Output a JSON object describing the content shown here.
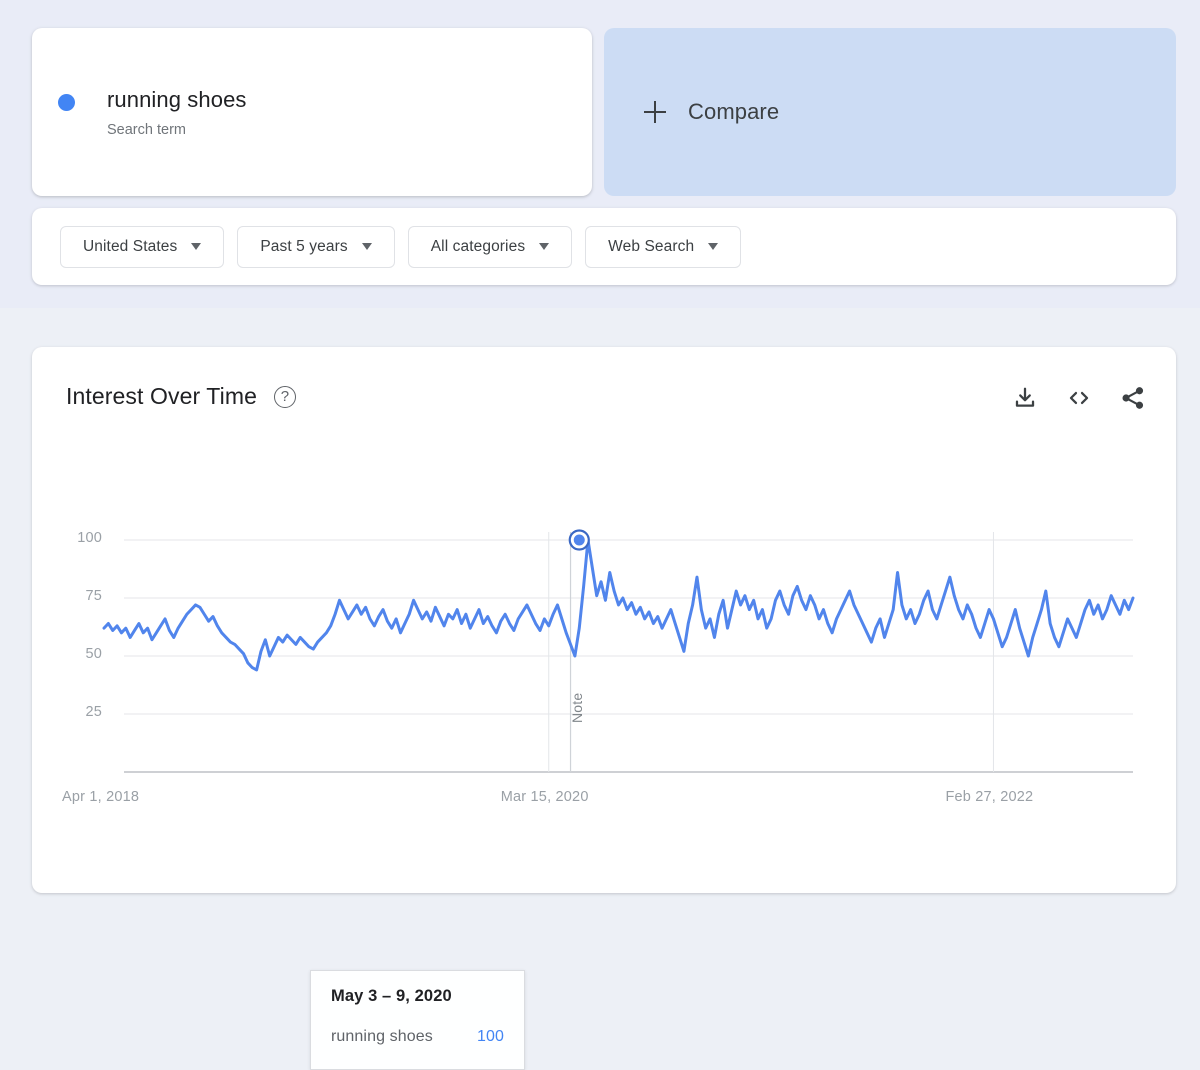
{
  "colors": {
    "series": "#5185ec",
    "series_dark": "#3b68c4",
    "accent_text": "#4285f4",
    "top_band": "#e9ecf7",
    "page_bg": "#edf0f6",
    "compare_bg": "#ccdcf4"
  },
  "term_card": {
    "name": "running shoes",
    "subtitle": "Search term",
    "dot_color": "#4285f4"
  },
  "compare_card": {
    "label": "Compare",
    "plus_icon": "plus-icon"
  },
  "filters": [
    {
      "label": "United States",
      "caret": "chevron-down-icon"
    },
    {
      "label": "Past 5 years",
      "caret": "chevron-down-icon"
    },
    {
      "label": "All categories",
      "caret": "chevron-down-icon"
    },
    {
      "label": "Web Search",
      "caret": "chevron-down-icon"
    }
  ],
  "chart_panel": {
    "title": "Interest Over Time",
    "help_icon": "help-icon",
    "help_glyph": "?",
    "actions": [
      {
        "name": "download-icon",
        "label": "Download CSV"
      },
      {
        "name": "embed-code-icon",
        "label": "Embed code"
      },
      {
        "name": "share-icon",
        "label": "Share"
      }
    ]
  },
  "tooltip": {
    "date": "May 3 – 9, 2020",
    "term": "running shoes",
    "value": "100"
  },
  "annotation": {
    "label": "Note",
    "x_value": 107
  },
  "chart_data": {
    "type": "line",
    "title": "Interest Over Time",
    "xlabel": "",
    "ylabel": "",
    "ylim": [
      0,
      100
    ],
    "yticks": [
      100,
      75,
      50,
      25
    ],
    "xticks": [
      "Apr 1, 2018",
      "Mar 15, 2020",
      "Feb 27, 2022"
    ],
    "xtick_indices": [
      0,
      102,
      204
    ],
    "grid": true,
    "legend": "none",
    "highlight": {
      "index": 109,
      "value": 100,
      "label": "May 3 – 9, 2020"
    },
    "series": [
      {
        "name": "running shoes",
        "color": "#5185ec",
        "values": [
          62,
          64,
          61,
          63,
          60,
          62,
          58,
          61,
          64,
          60,
          62,
          57,
          60,
          63,
          66,
          61,
          58,
          62,
          65,
          68,
          70,
          72,
          71,
          68,
          65,
          67,
          63,
          60,
          58,
          56,
          55,
          53,
          51,
          47,
          45,
          44,
          52,
          57,
          50,
          54,
          58,
          56,
          59,
          57,
          55,
          58,
          56,
          54,
          53,
          56,
          58,
          60,
          63,
          68,
          74,
          70,
          66,
          69,
          72,
          68,
          71,
          66,
          63,
          67,
          70,
          65,
          62,
          66,
          60,
          64,
          68,
          74,
          70,
          66,
          69,
          65,
          71,
          67,
          63,
          68,
          66,
          70,
          64,
          68,
          62,
          66,
          70,
          64,
          67,
          63,
          60,
          65,
          68,
          64,
          61,
          66,
          69,
          72,
          68,
          64,
          61,
          66,
          63,
          68,
          72,
          66,
          60,
          55,
          50,
          62,
          80,
          100,
          88,
          76,
          82,
          74,
          86,
          78,
          72,
          75,
          70,
          73,
          68,
          71,
          66,
          69,
          64,
          67,
          62,
          66,
          70,
          64,
          58,
          52,
          64,
          72,
          84,
          70,
          62,
          66,
          58,
          68,
          74,
          62,
          70,
          78,
          72,
          76,
          70,
          74,
          66,
          70,
          62,
          66,
          74,
          78,
          72,
          68,
          76,
          80,
          74,
          70,
          76,
          72,
          66,
          70,
          64,
          60,
          66,
          70,
          74,
          78,
          72,
          68,
          64,
          60,
          56,
          62,
          66,
          58,
          64,
          70,
          86,
          72,
          66,
          70,
          64,
          68,
          74,
          78,
          70,
          66,
          72,
          78,
          84,
          76,
          70,
          66,
          72,
          68,
          62,
          58,
          64,
          70,
          66,
          60,
          54,
          58,
          64,
          70,
          62,
          56,
          50,
          58,
          64,
          70,
          78,
          64,
          58,
          54,
          60,
          66,
          62,
          58,
          64,
          70,
          74,
          68,
          72,
          66,
          70,
          76,
          72,
          68,
          74,
          70,
          75
        ]
      }
    ]
  }
}
